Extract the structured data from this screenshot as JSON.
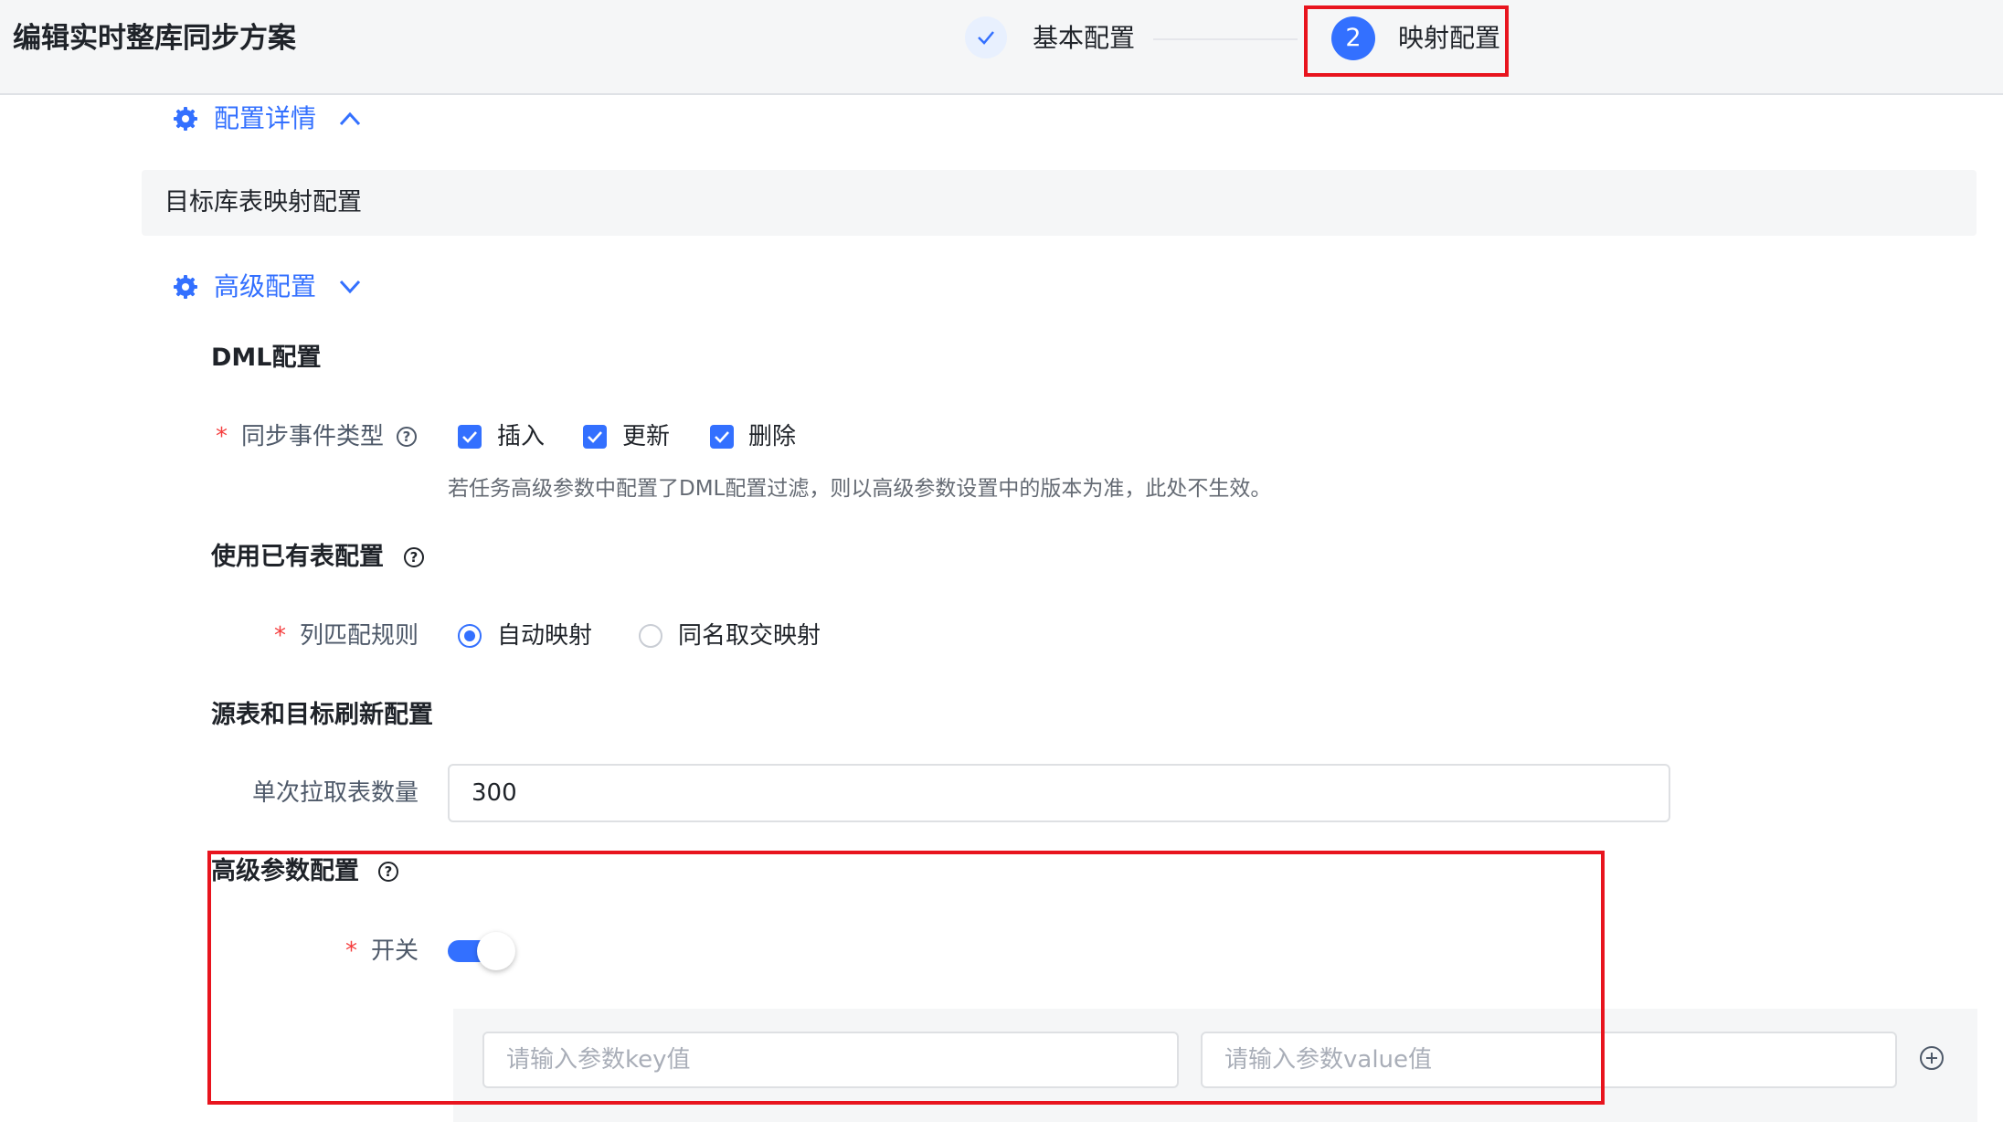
{
  "header": {
    "title": "编辑实时整库同步方案",
    "steps": [
      {
        "label": "基本配置",
        "status": "done"
      },
      {
        "number": "2",
        "label": "映射配置",
        "status": "active"
      }
    ]
  },
  "sections": {
    "config_details": {
      "title": "配置详情"
    },
    "target_mapping": {
      "title": "目标库表映射配置"
    },
    "advanced": {
      "title": "高级配置"
    }
  },
  "dml": {
    "title": "DML配置",
    "event_type_label": "同步事件类型",
    "options": [
      "插入",
      "更新",
      "删除"
    ],
    "help_text": "若任务高级参数中配置了DML配置过滤，则以高级参数设置中的版本为准，此处不生效。"
  },
  "existing_table": {
    "title": "使用已有表配置",
    "column_rule_label": "列匹配规则",
    "options": [
      "自动映射",
      "同名取交映射"
    ],
    "selected": "自动映射"
  },
  "refresh": {
    "title": "源表和目标刷新配置",
    "batch_label": "单次拉取表数量",
    "batch_value": "300"
  },
  "advanced_params": {
    "title": "高级参数配置",
    "switch_label": "开关",
    "switch_on": true,
    "key_placeholder": "请输入参数key值",
    "value_placeholder": "请输入参数value值"
  },
  "colors": {
    "primary": "#3370ff",
    "highlight": "#e8141e",
    "required": "#f53f3f"
  }
}
